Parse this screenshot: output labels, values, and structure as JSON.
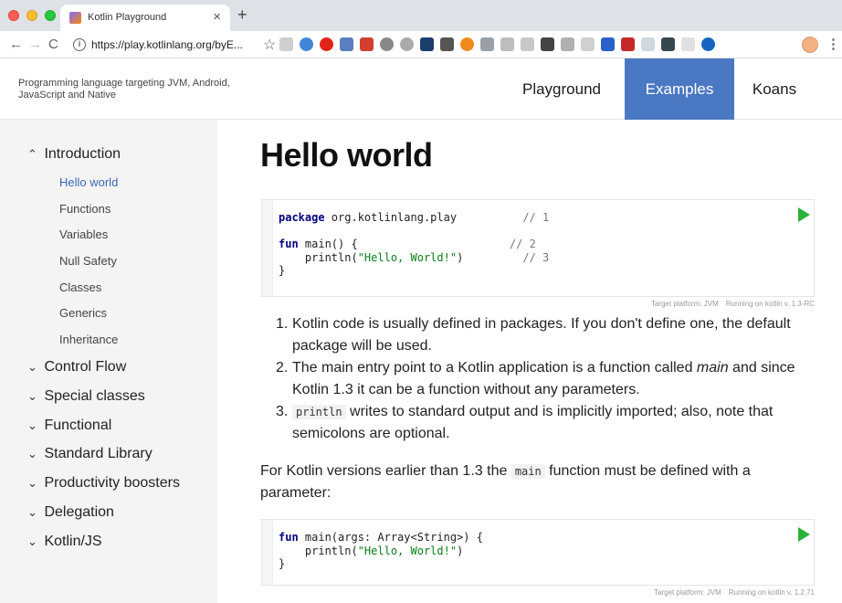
{
  "browser": {
    "tab_title": "Kotlin Playground",
    "tab_close": "×",
    "new_tab": "+",
    "back": "←",
    "forward": "→",
    "reload": "C",
    "url": "https://play.kotlinlang.org/byE...",
    "star": "☆",
    "menu": "⋮",
    "extensions": [
      "ext-1",
      "ext-2",
      "ext-3",
      "ext-4",
      "ext-5",
      "ext-6",
      "ext-7",
      "ext-8",
      "ext-9",
      "ext-10",
      "ext-11",
      "ext-12",
      "ext-13",
      "ext-14",
      "ext-15",
      "ext-16",
      "ext-17",
      "ext-18",
      "ext-19",
      "ext-20",
      "ext-21",
      "ext-22",
      "ext-23",
      "ext-24",
      "ext-25"
    ]
  },
  "header": {
    "tagline": "Programming language targeting JVM, Android, JavaScript and Native",
    "nav": {
      "playground": "Playground",
      "examples": "Examples",
      "koans": "Koans"
    }
  },
  "sidebar": {
    "sections": [
      {
        "chev": "^",
        "label": "Introduction"
      },
      {
        "chev": "v",
        "label": "Control Flow"
      },
      {
        "chev": "v",
        "label": "Special classes"
      },
      {
        "chev": "v",
        "label": "Functional"
      },
      {
        "chev": "v",
        "label": "Standard Library"
      },
      {
        "chev": "v",
        "label": "Productivity boosters"
      },
      {
        "chev": "v",
        "label": "Delegation"
      },
      {
        "chev": "v",
        "label": "Kotlin/JS"
      }
    ],
    "intro_items": [
      "Hello world",
      "Functions",
      "Variables",
      "Null Safety",
      "Classes",
      "Generics",
      "Inheritance"
    ]
  },
  "main": {
    "title": "Hello world",
    "code1": {
      "l1_kw": "package",
      "l1_rest": " org.kotlinlang.play",
      "l1_cm": "// 1",
      "l3_kw": "fun",
      "l3_rest": " main() {",
      "l3_cm": "// 2",
      "l4_a": "    println(",
      "l4_str": "\"Hello, World!\"",
      "l4_b": ")",
      "l4_cm": "// 3",
      "l5": "}"
    },
    "platform1": {
      "target": "Target platform: JVM",
      "running": "Running on kotlin v. 1.3-RC"
    },
    "list": [
      {
        "num": "1.",
        "text": "Kotlin code is usually defined in packages. If you don't define one, the default package will be used."
      },
      {
        "num": "2.",
        "text_a": "The main entry point to a Kotlin application is a function called ",
        "em": "main",
        "text_b": " and since Kotlin 1.3 it can be a function without any parameters."
      },
      {
        "num": "3.",
        "code": "println",
        "text": " writes to standard output and is implicitly imported; also, note that semicolons are optional."
      }
    ],
    "para": {
      "a": "For Kotlin versions earlier than 1.3 the ",
      "code": "main",
      "b": " function must be defined with a parameter:"
    },
    "code2": {
      "l1_kw": "fun",
      "l1_rest": " main(args: Array<String>) {",
      "l2_a": "    println(",
      "l2_str": "\"Hello, World!\"",
      "l2_b": ")",
      "l3": "}"
    },
    "platform2": {
      "target": "Target platform: JVM",
      "running": "Running on kotlin v. 1.2.71"
    }
  },
  "colors": {
    "accent": "#4a78c2",
    "run": "#2ab33a",
    "active_link": "#3c67b5"
  }
}
